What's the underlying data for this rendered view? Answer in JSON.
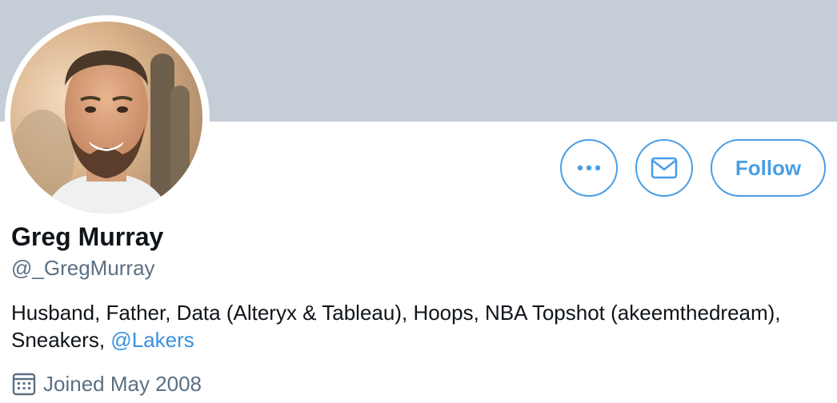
{
  "profile": {
    "display_name": "Greg Murray",
    "handle": "@_GregMurray",
    "bio_text": "Husband, Father, Data (Alteryx & Tableau), Hoops, NBA Topshot (akeemthedream), Sneakers, ",
    "bio_mention": "@Lakers",
    "joined": "Joined May 2008"
  },
  "actions": {
    "more_icon": "ellipsis-icon",
    "message_icon": "envelope-icon",
    "follow_label": "Follow"
  },
  "colors": {
    "banner": "#c5ced7",
    "accent": "#4a9ee5",
    "secondary_text": "#5b7083",
    "primary_text": "#0f1419"
  }
}
